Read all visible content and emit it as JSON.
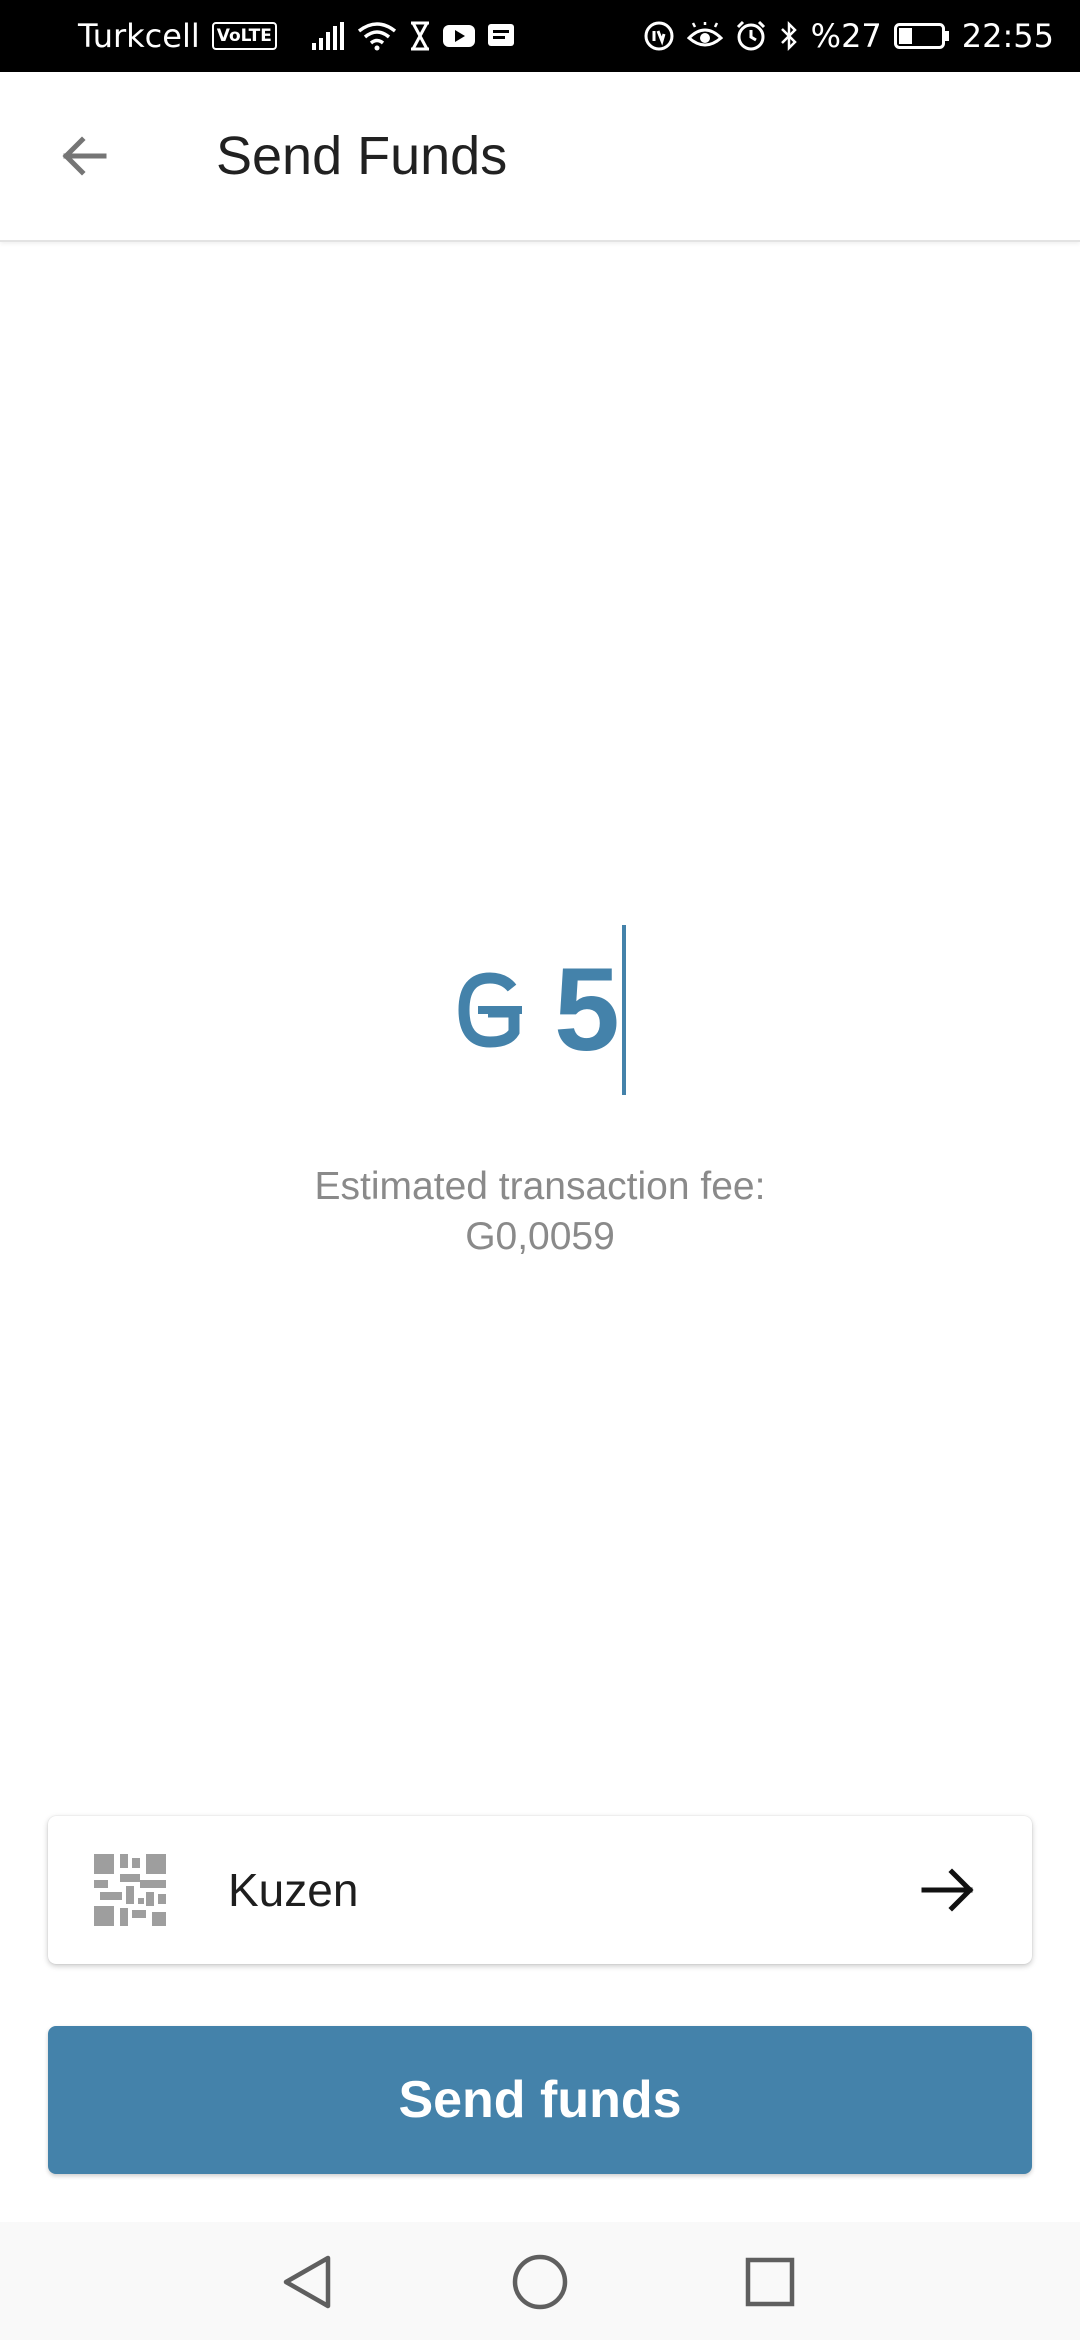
{
  "status_bar": {
    "carrier": "Turkcell",
    "volte": "VoLTE",
    "battery": "%27",
    "time": "22:55"
  },
  "app_bar": {
    "title": "Send Funds",
    "back_icon": "arrow-left-icon"
  },
  "amount": {
    "currency_symbol": "G",
    "value": "5"
  },
  "fee": {
    "label": "Estimated transaction fee:",
    "value": "G0,0059"
  },
  "recipient": {
    "name": "Kuzen",
    "icon": "qr-code-icon",
    "action_icon": "arrow-right-icon"
  },
  "send_button": {
    "label": "Send funds"
  },
  "colors": {
    "accent": "#4482aa",
    "fee_text": "#8a8a8a",
    "qr_gray": "#9e9e9e"
  }
}
